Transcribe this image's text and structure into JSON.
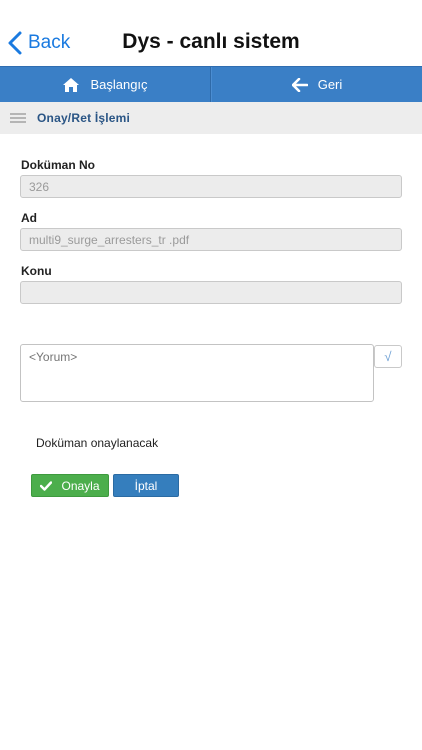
{
  "navbar": {
    "back_label": "Back",
    "title": "Dys - canlı sistem"
  },
  "toolbar": {
    "home_label": "Başlangıç",
    "home_icon": "home-icon",
    "back_label": "Geri",
    "back_icon": "arrow-left-icon",
    "color": "#3a7fc6"
  },
  "subheader": {
    "title": "Onay/Ret İşlemi",
    "menu_icon": "hamburger-icon"
  },
  "form": {
    "document_no": {
      "label": "Doküman No",
      "value": "326"
    },
    "name": {
      "label": "Ad",
      "value": "multi9_surge_arresters_tr .pdf"
    },
    "subject": {
      "label": "Konu",
      "value": ""
    },
    "comment": {
      "placeholder": "<Yorum>",
      "value": ""
    },
    "sqrt_button": "√"
  },
  "status_text": "Doküman onaylanacak",
  "actions": {
    "approve_label": "Onayla",
    "approve_color": "#4cae4c",
    "cancel_label": "İptal",
    "cancel_color": "#357ebd"
  }
}
